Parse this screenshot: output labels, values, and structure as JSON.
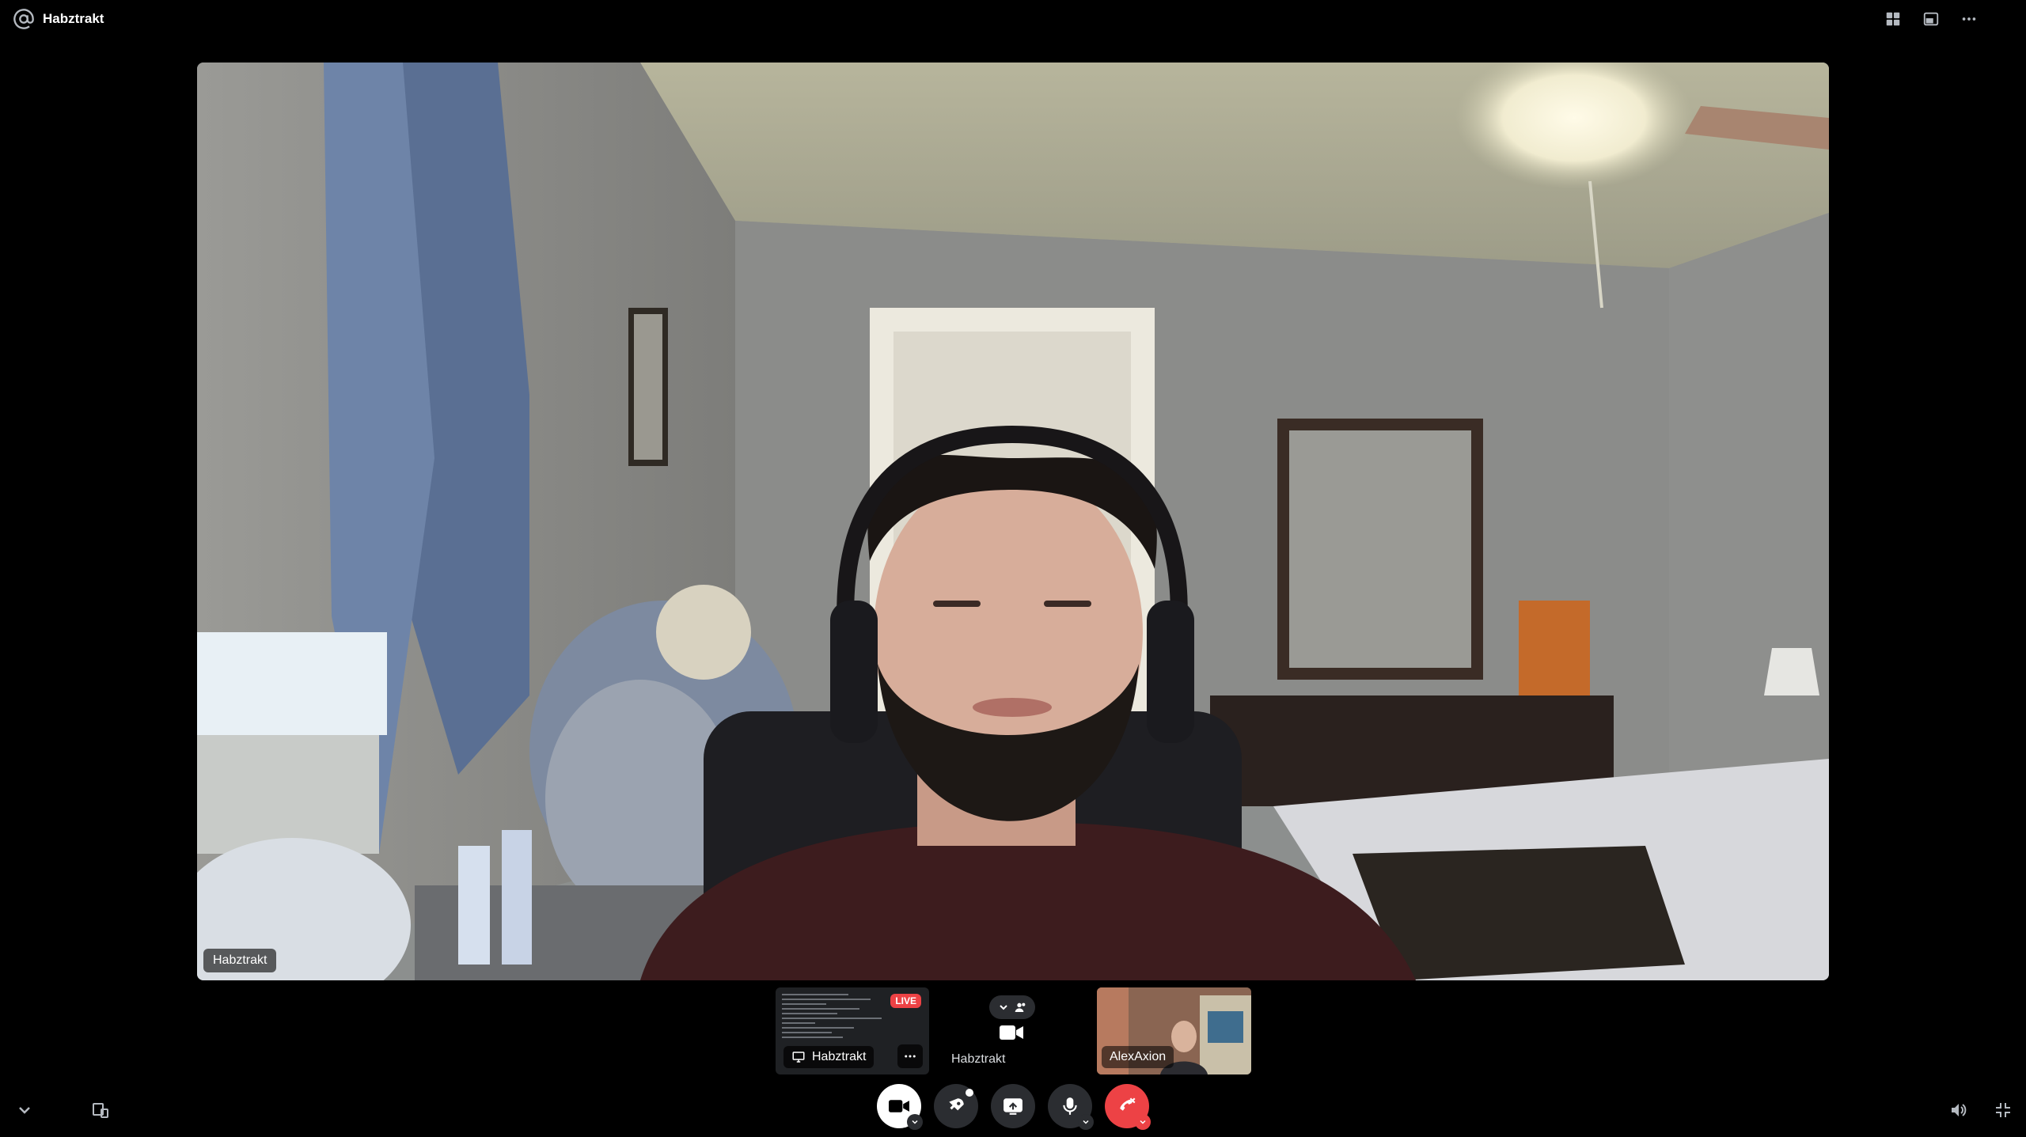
{
  "call": {
    "title": "Habztrakt",
    "title_icon": "at-sign-icon"
  },
  "top_actions": [
    {
      "name": "grid-layout-icon"
    },
    {
      "name": "popout-window-icon"
    },
    {
      "name": "more-options-icon"
    }
  ],
  "main_video": {
    "participant": "Habztrakt"
  },
  "tiles": {
    "screen_share": {
      "live_badge": "LIVE",
      "label": "Habztrakt"
    },
    "self": {
      "label": "Habztrakt"
    },
    "other": {
      "label": "AlexAxion"
    }
  },
  "controls": [
    {
      "name": "camera-button",
      "icon": "video-camera-icon"
    },
    {
      "name": "activities-button",
      "icon": "rocket-icon"
    },
    {
      "name": "share-screen-button",
      "icon": "screen-share-icon"
    },
    {
      "name": "mute-button",
      "icon": "microphone-icon"
    },
    {
      "name": "disconnect-button",
      "icon": "phone-hangup-icon"
    }
  ],
  "colors": {
    "background": "#000000",
    "button_dark": "#2b2d31",
    "danger": "#ed4245",
    "live_red": "#ed4245"
  }
}
